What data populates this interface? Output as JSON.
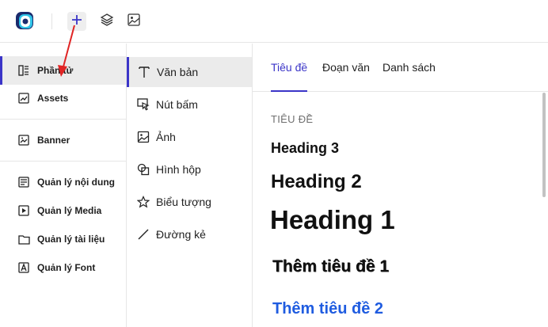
{
  "topbar": {
    "logo": "app-logo",
    "icons": [
      "plus-icon",
      "layers-icon",
      "image-icon"
    ]
  },
  "sidebar": {
    "items": [
      {
        "label": "Phần tử",
        "icon": "elements-icon"
      },
      {
        "label": "Assets",
        "icon": "assets-icon"
      },
      {
        "label": "Banner",
        "icon": "banner-icon"
      },
      {
        "label": "Quản lý nội dung",
        "icon": "content-icon"
      },
      {
        "label": "Quản lý Media",
        "icon": "media-icon"
      },
      {
        "label": "Quản lý tài liệu",
        "icon": "folder-icon"
      },
      {
        "label": "Quản lý Font",
        "icon": "font-icon"
      }
    ]
  },
  "elements": {
    "items": [
      {
        "label": "Văn bản",
        "icon": "text-icon"
      },
      {
        "label": "Nút bấm",
        "icon": "cursor-icon"
      },
      {
        "label": "Ảnh",
        "icon": "image-icon"
      },
      {
        "label": "Hình hộp",
        "icon": "shapes-icon"
      },
      {
        "label": "Biểu tượng",
        "icon": "star-icon"
      },
      {
        "label": "Đường kẻ",
        "icon": "line-icon"
      }
    ]
  },
  "content": {
    "tabs": [
      "Tiêu đề",
      "Đoạn văn",
      "Danh sách"
    ],
    "section_label": "TIÊU ĐỀ",
    "heading3": "Heading 3",
    "heading2": "Heading 2",
    "heading1": "Heading 1",
    "add_heading_1": "Thêm tiêu đề 1",
    "add_heading_2": "Thêm tiêu đề 2"
  },
  "colors": {
    "accent": "#3b35c8",
    "link_blue": "#1f5ce0",
    "annotation_red": "#e02424"
  }
}
